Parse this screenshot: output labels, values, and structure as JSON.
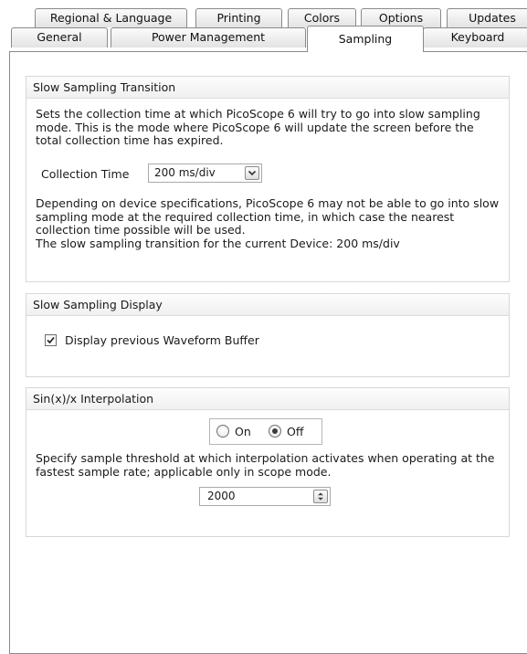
{
  "tabs": {
    "row1": [
      {
        "label": "Regional & Language"
      },
      {
        "label": "Printing"
      },
      {
        "label": "Colors"
      },
      {
        "label": "Options"
      },
      {
        "label": "Updates"
      }
    ],
    "row2": [
      {
        "label": "General"
      },
      {
        "label": "Power Management"
      },
      {
        "label": "Sampling"
      },
      {
        "label": "Keyboard"
      }
    ],
    "active": "Sampling"
  },
  "slow_transition": {
    "title": "Slow Sampling Transition",
    "description": "Sets the collection time at which PicoScope 6 will try to go into slow sampling mode. This is the mode where PicoScope 6 will update the screen before the total collection time has expired.",
    "collection_time_label": "Collection Time",
    "collection_time_value": "200 ms/div",
    "note": "Depending on device specifications, PicoScope 6 may not be able to go into slow sampling mode at the required collection time, in which case the nearest collection time possible will be used.",
    "current_device_line": "The slow sampling transition for the current Device: 200 ms/div"
  },
  "slow_display": {
    "title": "Slow Sampling Display",
    "checkbox_label": "Display previous Waveform Buffer",
    "checked": true
  },
  "interpolation": {
    "title": "Sin(x)/x Interpolation",
    "on_label": "On",
    "off_label": "Off",
    "selected": "Off",
    "description": "Specify sample threshold at which interpolation activates when operating at the fastest sample rate; applicable only in scope mode.",
    "threshold_value": "2000"
  },
  "icons": {
    "dropdown": "chevron-down-icon",
    "checkbox": "checkmark-icon",
    "spinner": "spinner-arrows-icon"
  },
  "colors": {
    "border": "#8a8a8a",
    "group_border": "#d7d7d7",
    "background": "#ffffff"
  }
}
